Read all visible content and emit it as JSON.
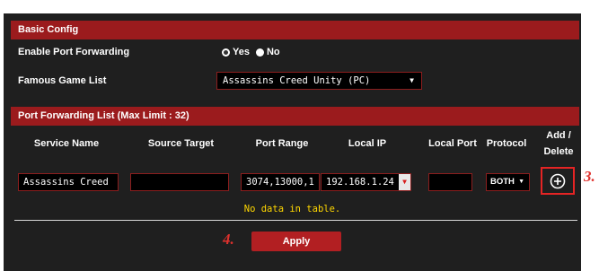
{
  "basic_config": {
    "title": "Basic Config",
    "enable_label": "Enable Port Forwarding",
    "yes_label": "Yes",
    "no_label": "No",
    "enabled": "Yes",
    "game_list_label": "Famous Game List",
    "game_selected": "Assassins Creed Unity (PC)"
  },
  "list": {
    "title": "Port Forwarding List (Max Limit : 32)",
    "columns": {
      "service_name": "Service Name",
      "source_target": "Source Target",
      "port_range": "Port Range",
      "local_ip": "Local IP",
      "local_port": "Local Port",
      "protocol": "Protocol",
      "add_line1": "Add /",
      "add_line2": "Delete"
    },
    "row": {
      "service_name": "Assassins Creed",
      "source_target": "",
      "port_range": "3074,13000,1",
      "local_ip": "192.168.1.24",
      "local_port": "",
      "protocol": "BOTH"
    },
    "empty_message": "No data in table."
  },
  "apply_label": "Apply",
  "steps": {
    "add": "3.",
    "apply": "4."
  },
  "colors": {
    "accent": "#9b1b1d",
    "panel": "#1f1f1f",
    "highlight": "#e52424",
    "empty_text": "#ffd700"
  },
  "icons": {
    "add": "plus-circle-icon",
    "dropdown": "triangle-down-icon"
  }
}
